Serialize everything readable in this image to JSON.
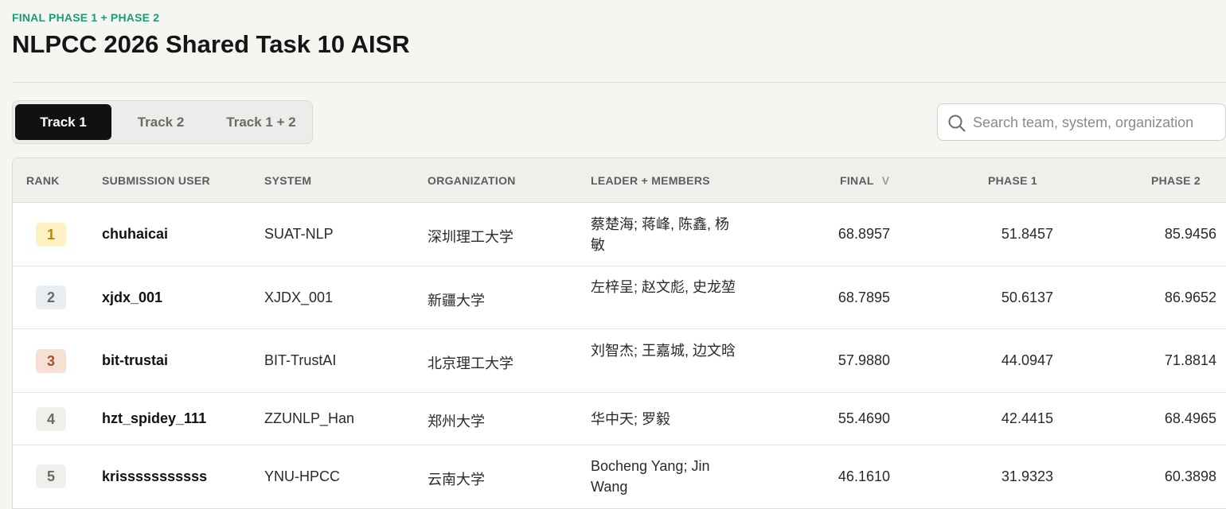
{
  "header": {
    "eyebrow": "FINAL PHASE 1 + PHASE 2",
    "title": "NLPCC 2026 Shared Task 10 AISR"
  },
  "tabs": [
    {
      "label": "Track 1",
      "active": true
    },
    {
      "label": "Track 2",
      "active": false
    },
    {
      "label": "Track 1 + 2",
      "active": false
    }
  ],
  "search": {
    "placeholder": "Search team, system, organization",
    "icon": "search-icon"
  },
  "table": {
    "columns": {
      "rank": "RANK",
      "user": "SUBMISSION USER",
      "system": "SYSTEM",
      "organization": "ORGANIZATION",
      "members": "LEADER + MEMBERS",
      "final": "FINAL",
      "final_sort": "V",
      "phase1": "PHASE 1",
      "phase2": "PHASE 2"
    },
    "rows": [
      {
        "rank": "1",
        "user": "chuhaicai",
        "system": "SUAT-NLP",
        "organization": "深圳理工大学",
        "members": "蔡楚海;  蒋峰, 陈鑫, 杨敏",
        "final": "68.8957",
        "phase1": "51.8457",
        "phase2": "85.9456"
      },
      {
        "rank": "2",
        "user": "xjdx_001",
        "system": "XJDX_001",
        "organization": "新疆大学",
        "members": "左梓呈;  赵文彪, 史龙堃",
        "final": "68.7895",
        "phase1": "50.6137",
        "phase2": "86.9652"
      },
      {
        "rank": "3",
        "user": "bit-trustai",
        "system": "BIT-TrustAI",
        "organization": "北京理工大学",
        "members": "刘智杰;  王嘉城, 边文晗",
        "final": "57.9880",
        "phase1": "44.0947",
        "phase2": "71.8814"
      },
      {
        "rank": "4",
        "user": "hzt_spidey_111",
        "system": "ZZUNLP_Han",
        "organization": "郑州大学",
        "members": "华中天; 罗毅",
        "final": "55.4690",
        "phase1": "42.4415",
        "phase2": "68.4965"
      },
      {
        "rank": "5",
        "user": "krisssssssssss",
        "system": "YNU-HPCC",
        "organization": "云南大学",
        "members": "Bocheng Yang; Jin Wang",
        "final": "46.1610",
        "phase1": "31.9323",
        "phase2": "60.3898"
      }
    ]
  },
  "colors": {
    "accent": "#1f9a78",
    "rank1_bg": "#fdf1c4",
    "rank1_fg": "#b8860b",
    "rank2_bg": "#e8edf2",
    "rank2_fg": "#5f6b78",
    "rank3_bg": "#f6e0d3",
    "rank3_fg": "#a0522d",
    "rank_other_bg": "#efefeb",
    "rank_other_fg": "#6b6b66"
  }
}
